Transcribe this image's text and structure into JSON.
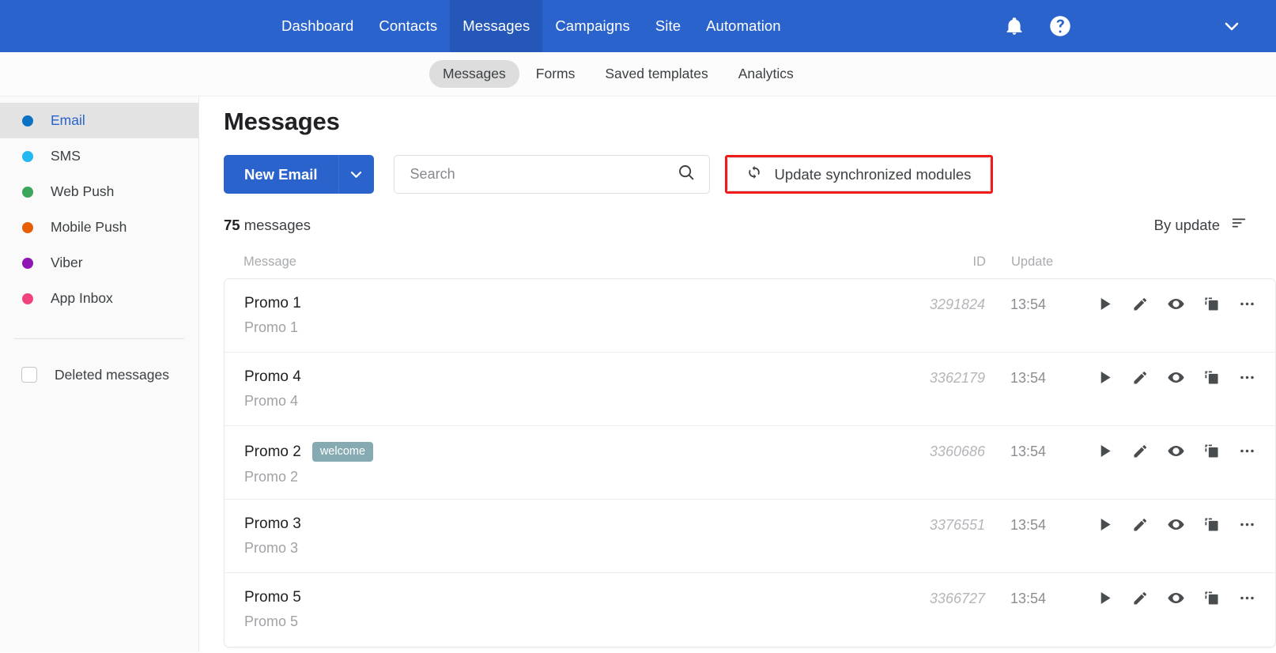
{
  "topnav": {
    "items": [
      {
        "label": "Dashboard",
        "active": false
      },
      {
        "label": "Contacts",
        "active": false
      },
      {
        "label": "Messages",
        "active": true
      },
      {
        "label": "Campaigns",
        "active": false
      },
      {
        "label": "Site",
        "active": false
      },
      {
        "label": "Automation",
        "active": false
      }
    ],
    "notifications_icon": "bell-icon",
    "help_icon": "help-circle-icon",
    "account_icon": "chevron-down-icon",
    "background_color": "#2b63cc",
    "active_background_color": "#2457b8"
  },
  "subnav": {
    "tabs": [
      {
        "label": "Messages",
        "active": true
      },
      {
        "label": "Forms",
        "active": false
      },
      {
        "label": "Saved templates",
        "active": false
      },
      {
        "label": "Analytics",
        "active": false
      }
    ]
  },
  "sidebar": {
    "channels": [
      {
        "label": "Email",
        "color": "#0b72c4",
        "active": true
      },
      {
        "label": "SMS",
        "color": "#22b8f0",
        "active": false
      },
      {
        "label": "Web Push",
        "color": "#3ba55c",
        "active": false
      },
      {
        "label": "Mobile Push",
        "color": "#e85d04",
        "active": false
      },
      {
        "label": "Viber",
        "color": "#8e16b5",
        "active": false
      },
      {
        "label": "App Inbox",
        "color": "#f0427e",
        "active": false
      }
    ],
    "deleted": {
      "label": "Deleted messages",
      "checked": false
    }
  },
  "main": {
    "title": "Messages",
    "new_button": {
      "label": "New Email",
      "caret_icon": "chevron-down-icon"
    },
    "search": {
      "value": "",
      "placeholder": "Search",
      "icon": "search-icon"
    },
    "sync_button": {
      "label": "Update synchronized modules",
      "icon": "refresh-sync-icon",
      "highlight_color": "#f01b1b",
      "highlighted": true
    },
    "count": {
      "number": "75",
      "unit": "messages"
    },
    "sort": {
      "label": "By update",
      "icon": "sort-descending-icon"
    },
    "columns": {
      "message": "Message",
      "id": "ID",
      "update": "Update",
      "actions": ""
    },
    "row_actions": [
      {
        "name": "send-button",
        "icon": "play-icon"
      },
      {
        "name": "edit-button",
        "icon": "pencil-icon"
      },
      {
        "name": "preview-button",
        "icon": "eye-icon"
      },
      {
        "name": "duplicate-button",
        "icon": "copy-icon"
      },
      {
        "name": "more-button",
        "icon": "ellipsis-icon"
      }
    ],
    "rows": [
      {
        "title": "Promo 1",
        "subtitle": "Promo 1",
        "tag": "",
        "id": "3291824",
        "update": "13:54"
      },
      {
        "title": "Promo 4",
        "subtitle": "Promo 4",
        "tag": "",
        "id": "3362179",
        "update": "13:54"
      },
      {
        "title": "Promo 2",
        "subtitle": "Promo 2",
        "tag": "welcome",
        "id": "3360686",
        "update": "13:54"
      },
      {
        "title": "Promo 3",
        "subtitle": "Promo 3",
        "tag": "",
        "id": "3376551",
        "update": "13:54"
      },
      {
        "title": "Promo 5",
        "subtitle": "Promo 5",
        "tag": "",
        "id": "3366727",
        "update": "13:54"
      }
    ]
  }
}
